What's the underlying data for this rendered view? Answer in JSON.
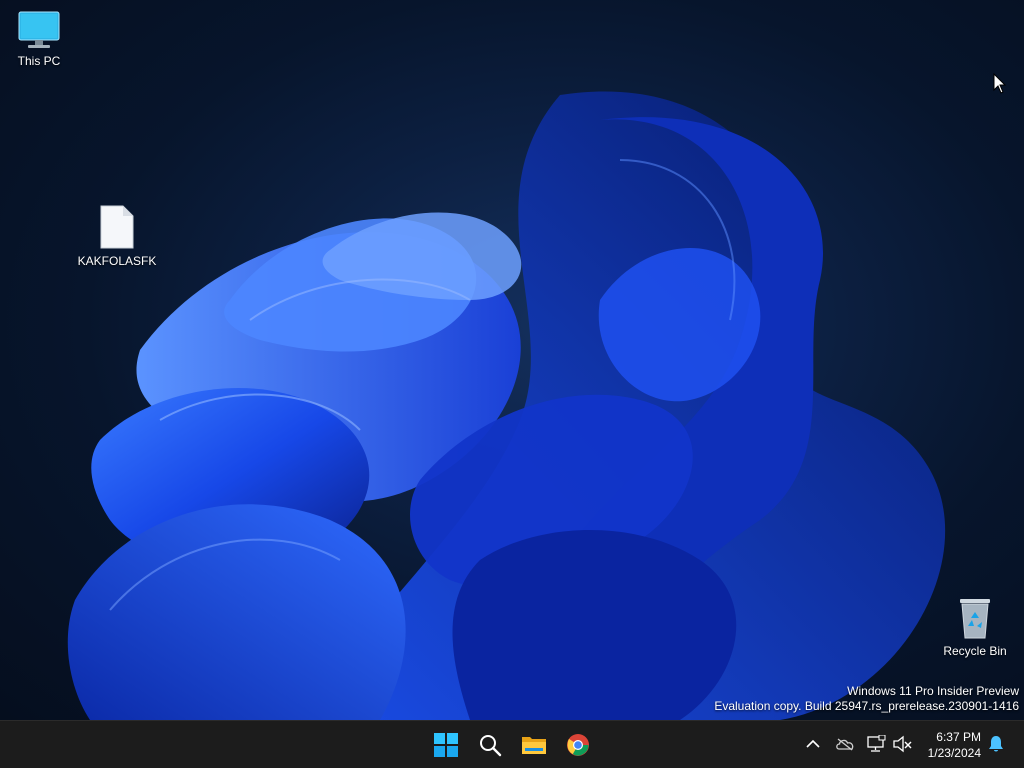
{
  "desktop": {
    "icons": [
      {
        "label": "This PC",
        "icon": "this-pc-icon"
      },
      {
        "label": "KAKFOLASFK",
        "icon": "file-icon"
      },
      {
        "label": "Recycle Bin",
        "icon": "recycle-bin-icon"
      }
    ],
    "watermark": {
      "line1": "Windows 11 Pro Insider Preview",
      "line2": "Evaluation copy. Build 25947.rs_prerelease.230901-1416"
    }
  },
  "taskbar": {
    "apps": [
      {
        "name": "Start",
        "icon": "windows-logo-icon"
      },
      {
        "name": "Search",
        "icon": "search-icon"
      },
      {
        "name": "File Explorer",
        "icon": "folder-icon"
      },
      {
        "name": "Google Chrome",
        "icon": "chrome-icon"
      }
    ],
    "tray": {
      "icons": [
        "chevron-up-icon",
        "onedrive-icon",
        "network-icon",
        "volume-muted-icon",
        "notification-bell-icon"
      ],
      "time": "6:37 PM",
      "date": "1/23/2024"
    }
  },
  "colors": {
    "taskbar_bg": "#1c1c1c",
    "windows_blue": "#00a4ef",
    "wallpaper_bloom": "#1f5cff"
  }
}
